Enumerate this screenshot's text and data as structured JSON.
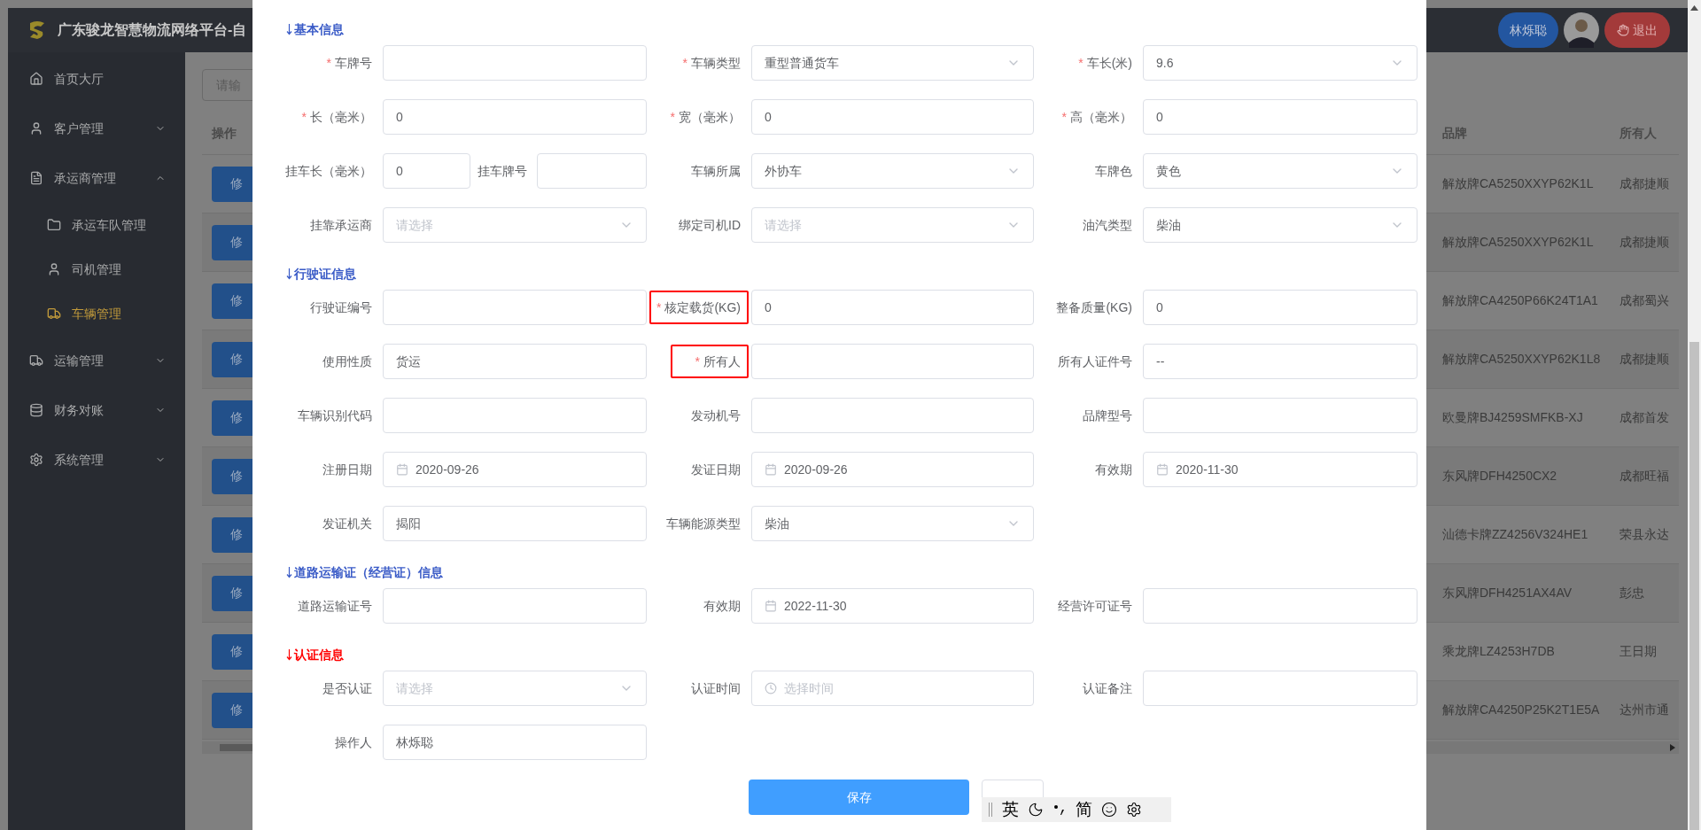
{
  "header": {
    "title": "广东骏龙智慧物流网络平台-自",
    "user": "林烁聪",
    "logout": "退出"
  },
  "sidebar": {
    "items": [
      {
        "label": "首页大厅",
        "kind": "link",
        "selected": false
      },
      {
        "label": "客户管理",
        "kind": "group",
        "expanded": false,
        "selected": false
      },
      {
        "label": "承运商管理",
        "kind": "group",
        "expanded": true,
        "selected": false,
        "children": [
          {
            "label": "承运车队管理",
            "selected": false
          },
          {
            "label": "司机管理",
            "selected": false
          },
          {
            "label": "车辆管理",
            "selected": true
          }
        ]
      },
      {
        "label": "运输管理",
        "kind": "group",
        "expanded": false,
        "selected": false
      },
      {
        "label": "财务对账",
        "kind": "group",
        "expanded": false,
        "selected": false
      },
      {
        "label": "系统管理",
        "kind": "group",
        "expanded": false,
        "selected": false
      }
    ]
  },
  "search": {
    "placeholder": "请输"
  },
  "table": {
    "columns": [
      "操作",
      "品牌",
      "所有人"
    ],
    "rows": [
      {
        "action": "修",
        "brand": "解放牌CA5250XXYP62K1L",
        "owner": "成都捷顺"
      },
      {
        "action": "修",
        "brand": "解放牌CA5250XXYP62K1L",
        "owner": "成都捷顺"
      },
      {
        "action": "修",
        "brand": "解放牌CA4250P66K24T1A1",
        "owner": "成都蜀兴"
      },
      {
        "action": "修",
        "brand": "解放牌CA5250XXYP62K1L8",
        "owner": "成都捷顺"
      },
      {
        "action": "修",
        "brand": "欧曼牌BJ4259SMFKB-XJ",
        "owner": "成都首发"
      },
      {
        "action": "修",
        "brand": "东风牌DFH4250CX2",
        "owner": "成都旺福"
      },
      {
        "action": "修",
        "brand": "汕德卡牌ZZ4256V324HE1",
        "owner": "荣县永达"
      },
      {
        "action": "修",
        "brand": "东风牌DFH4251AX4AV",
        "owner": "彭忠"
      },
      {
        "action": "修",
        "brand": "乘龙牌LZ4253H7DB",
        "owner": "王日期"
      },
      {
        "action": "修",
        "brand": "解放牌CA4250P25K2T1E5A",
        "owner": "达州市通"
      }
    ]
  },
  "dialog": {
    "sections": [
      {
        "title": "基本信息",
        "color": "#3a5bc7",
        "rows": [
          [
            {
              "label": "车牌号",
              "kind": "text",
              "required_mark": "*",
              "highlighted": false
            },
            {
              "label": "车辆类型",
              "kind": "select",
              "value": "重型普通货车",
              "required_mark": "*",
              "highlighted": false
            },
            {
              "label": "车长(米)",
              "kind": "select",
              "value": "9.6",
              "required_mark": "*",
              "highlighted": false
            }
          ],
          [
            {
              "label": "长（毫米）",
              "kind": "text",
              "value": "0",
              "required_mark": "*",
              "highlighted": false
            },
            {
              "label": "宽（毫米）",
              "kind": "text",
              "value": "0",
              "required_mark": "*",
              "highlighted": false
            },
            {
              "label": "高（毫米）",
              "kind": "text",
              "value": "0",
              "required_mark": "*",
              "highlighted": false
            }
          ],
          [
            {
              "label": "挂车长（毫米）",
              "kind": "text",
              "value": "0",
              "highlighted": false,
              "inline_field": {
                "label": "挂车牌号",
                "kind": "text"
              }
            },
            {
              "label": "车辆所属",
              "kind": "select",
              "value": "外协车",
              "highlighted": false
            },
            {
              "label": "车牌色",
              "kind": "select",
              "value": "黄色",
              "highlighted": false
            }
          ],
          [
            {
              "label": "挂靠承运商",
              "kind": "select",
              "placeholder": "请选择",
              "highlighted": false
            },
            {
              "label": "绑定司机ID",
              "kind": "select",
              "placeholder": "请选择",
              "highlighted": false
            },
            {
              "label": "油汽类型",
              "kind": "select",
              "value": "柴油",
              "highlighted": false
            }
          ]
        ]
      },
      {
        "title": "行驶证信息",
        "color": "#3a5bc7",
        "rows": [
          [
            {
              "label": "行驶证编号",
              "kind": "text",
              "highlighted": false
            },
            {
              "label": "核定载货(KG)",
              "kind": "text",
              "value": "0",
              "required_mark": "*",
              "highlighted": true
            },
            {
              "label": "整备质量(KG)",
              "kind": "text",
              "value": "0",
              "highlighted": false
            }
          ],
          [
            {
              "label": "使用性质",
              "kind": "text",
              "value": "货运",
              "highlighted": false
            },
            {
              "label": "所有人",
              "kind": "text",
              "required_mark": "*",
              "highlighted": true
            },
            {
              "label": "所有人证件号",
              "kind": "text",
              "value": "--",
              "highlighted": false
            }
          ],
          [
            {
              "label": "车辆识别代码",
              "kind": "text",
              "highlighted": false
            },
            {
              "label": "发动机号",
              "kind": "text",
              "highlighted": false
            },
            {
              "label": "品牌型号",
              "kind": "text",
              "highlighted": false
            }
          ],
          [
            {
              "label": "注册日期",
              "kind": "date",
              "value": "2020-09-26",
              "highlighted": false
            },
            {
              "label": "发证日期",
              "kind": "date",
              "value": "2020-09-26",
              "highlighted": false
            },
            {
              "label": "有效期",
              "kind": "date",
              "value": "2020-11-30",
              "highlighted": false
            }
          ],
          [
            {
              "label": "发证机关",
              "kind": "text",
              "value": "揭阳",
              "highlighted": false
            },
            {
              "label": "车辆能源类型",
              "kind": "select",
              "value": "柴油",
              "highlighted": false
            }
          ]
        ]
      },
      {
        "title": "道路运输证（经营证）信息",
        "color": "#3a5bc7",
        "rows": [
          [
            {
              "label": "道路运输证号",
              "kind": "text",
              "highlighted": false
            },
            {
              "label": "有效期",
              "kind": "date",
              "value": "2022-11-30",
              "highlighted": false
            },
            {
              "label": "经营许可证号",
              "kind": "text",
              "highlighted": false
            }
          ]
        ]
      },
      {
        "title": "认证信息",
        "color": "#ff0000",
        "rows": [
          [
            {
              "label": "是否认证",
              "kind": "select",
              "placeholder": "请选择",
              "highlighted": false
            },
            {
              "label": "认证时间",
              "kind": "time",
              "placeholder": "选择时间",
              "highlighted": false
            },
            {
              "label": "认证备注",
              "kind": "text",
              "highlighted": false
            }
          ],
          [
            {
              "label": "操作人",
              "kind": "text",
              "value": "林烁聪",
              "highlighted": false
            }
          ]
        ]
      }
    ],
    "buttons": [
      {
        "kind": "primary",
        "label": "保存"
      },
      {
        "kind": "secondary"
      }
    ]
  },
  "ime_toolbar": {
    "mode": "英",
    "script": "简"
  }
}
